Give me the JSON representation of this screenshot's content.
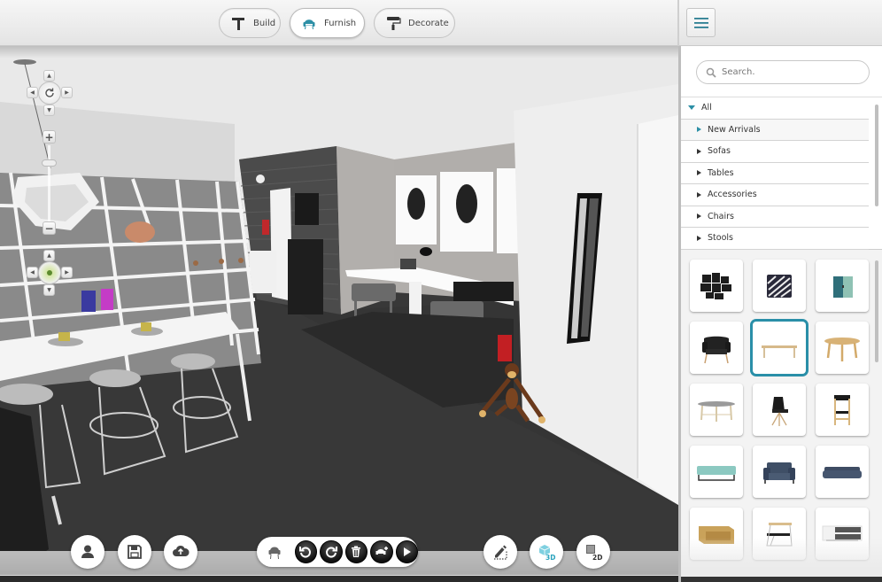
{
  "toolbar": {
    "modes": [
      {
        "id": "build",
        "label": "Build",
        "icon": "hammer-icon",
        "active": false
      },
      {
        "id": "furnish",
        "label": "Furnish",
        "icon": "armchair-icon",
        "active": true
      },
      {
        "id": "decorate",
        "label": "Decorate",
        "icon": "paint-roller-icon",
        "active": false
      }
    ],
    "menu_icon": "hamburger-menu-icon"
  },
  "panel": {
    "search": {
      "placeholder": "Search.",
      "value": ""
    },
    "categories": [
      {
        "label": "All",
        "expanded": true,
        "level": 0
      },
      {
        "label": "New Arrivals",
        "level": 1,
        "selected": true
      },
      {
        "label": "Sofas",
        "level": 1
      },
      {
        "label": "Tables",
        "level": 1
      },
      {
        "label": "Accessories",
        "level": 1
      },
      {
        "label": "Chairs",
        "level": 1
      },
      {
        "label": "Stools",
        "level": 1
      }
    ],
    "products": [
      {
        "name": "black-frame-cluster",
        "selected": false
      },
      {
        "name": "striped-cushion",
        "selected": false
      },
      {
        "name": "teal-wall-cabinet",
        "selected": false
      },
      {
        "name": "black-lounge-armchair",
        "selected": false
      },
      {
        "name": "oak-dining-table",
        "selected": true
      },
      {
        "name": "round-oak-side-table",
        "selected": false
      },
      {
        "name": "grey-round-coffee-table",
        "selected": false
      },
      {
        "name": "black-shell-chair",
        "selected": false
      },
      {
        "name": "oak-folding-chair",
        "selected": false
      },
      {
        "name": "mint-bench",
        "selected": false
      },
      {
        "name": "navy-armchair",
        "selected": false
      },
      {
        "name": "navy-sofa",
        "selected": false
      },
      {
        "name": "oak-box-shelf",
        "selected": false
      },
      {
        "name": "wire-lounge-chair",
        "selected": false
      },
      {
        "name": "white-grey-sideboard",
        "selected": false
      }
    ]
  },
  "bottom_bar": {
    "left_buttons": [
      "profile-icon",
      "save-icon",
      "upload-cloud-icon"
    ],
    "edit_tools": [
      "armchair-icon",
      "undo-icon",
      "redo-icon",
      "trash-icon",
      "add-furniture-icon",
      "play-icon"
    ],
    "view_buttons": [
      {
        "icon": "draw-room-icon",
        "label": ""
      },
      {
        "icon": "view-3d-icon",
        "label": "3D",
        "active": true
      },
      {
        "icon": "view-2d-icon",
        "label": "2D",
        "active": false
      }
    ]
  },
  "colors": {
    "accent": "#2a8fa8",
    "floor": "#3a3a3a",
    "brick": "#4d4d4d"
  }
}
